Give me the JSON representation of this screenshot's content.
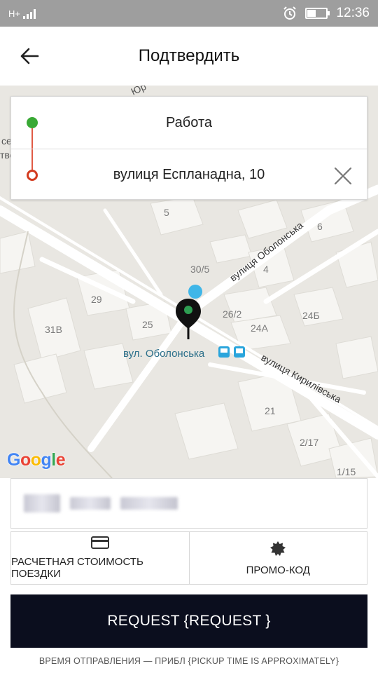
{
  "status_bar": {
    "network": "H+",
    "time": "12:36"
  },
  "header": {
    "title": "Подтвердить"
  },
  "route": {
    "origin": "Работа",
    "destination": "вулиця Еспланадна, 10"
  },
  "map": {
    "streets": [
      "вулиця Оболонська",
      "вулиця Кирилівська",
      "вул. Оболонська"
    ],
    "house_numbers": [
      "5",
      "6",
      "30/5",
      "4",
      "29",
      "26/2",
      "24Б",
      "31В",
      "25",
      "24А",
      "21",
      "2/17",
      "1/15"
    ],
    "edge_fragments": [
      "се",
      "тво",
      "Юр"
    ],
    "logo": "Google",
    "colors": {
      "map_bg": "#e9e7e2",
      "building": "#f6f5f2",
      "road": "#ffffff",
      "pin": "#111111",
      "pin_center": "#2e9e52",
      "location_dot": "#3fb6e8",
      "transit": "#2aa5dc"
    }
  },
  "fare": {
    "blurred": true
  },
  "options": {
    "fare_estimate_label": "РАСЧЕТНАЯ СТОИМОСТЬ ПОЕЗДКИ",
    "fare_estimate_icon": "credit-card-icon",
    "promo_label": "ПРОМО-КОД",
    "promo_icon": "promo-badge-icon"
  },
  "request_button": {
    "label": "REQUEST {REQUEST }"
  },
  "pickup_note": "ВРЕМЯ ОТПРАВЛЕНИЯ — ПРИБЛ {PICKUP TIME IS APPROXIMATELY}",
  "colors": {
    "accent_dark": "#0b0e1e",
    "origin_green": "#39a935",
    "destination_red": "#d33b1f"
  }
}
